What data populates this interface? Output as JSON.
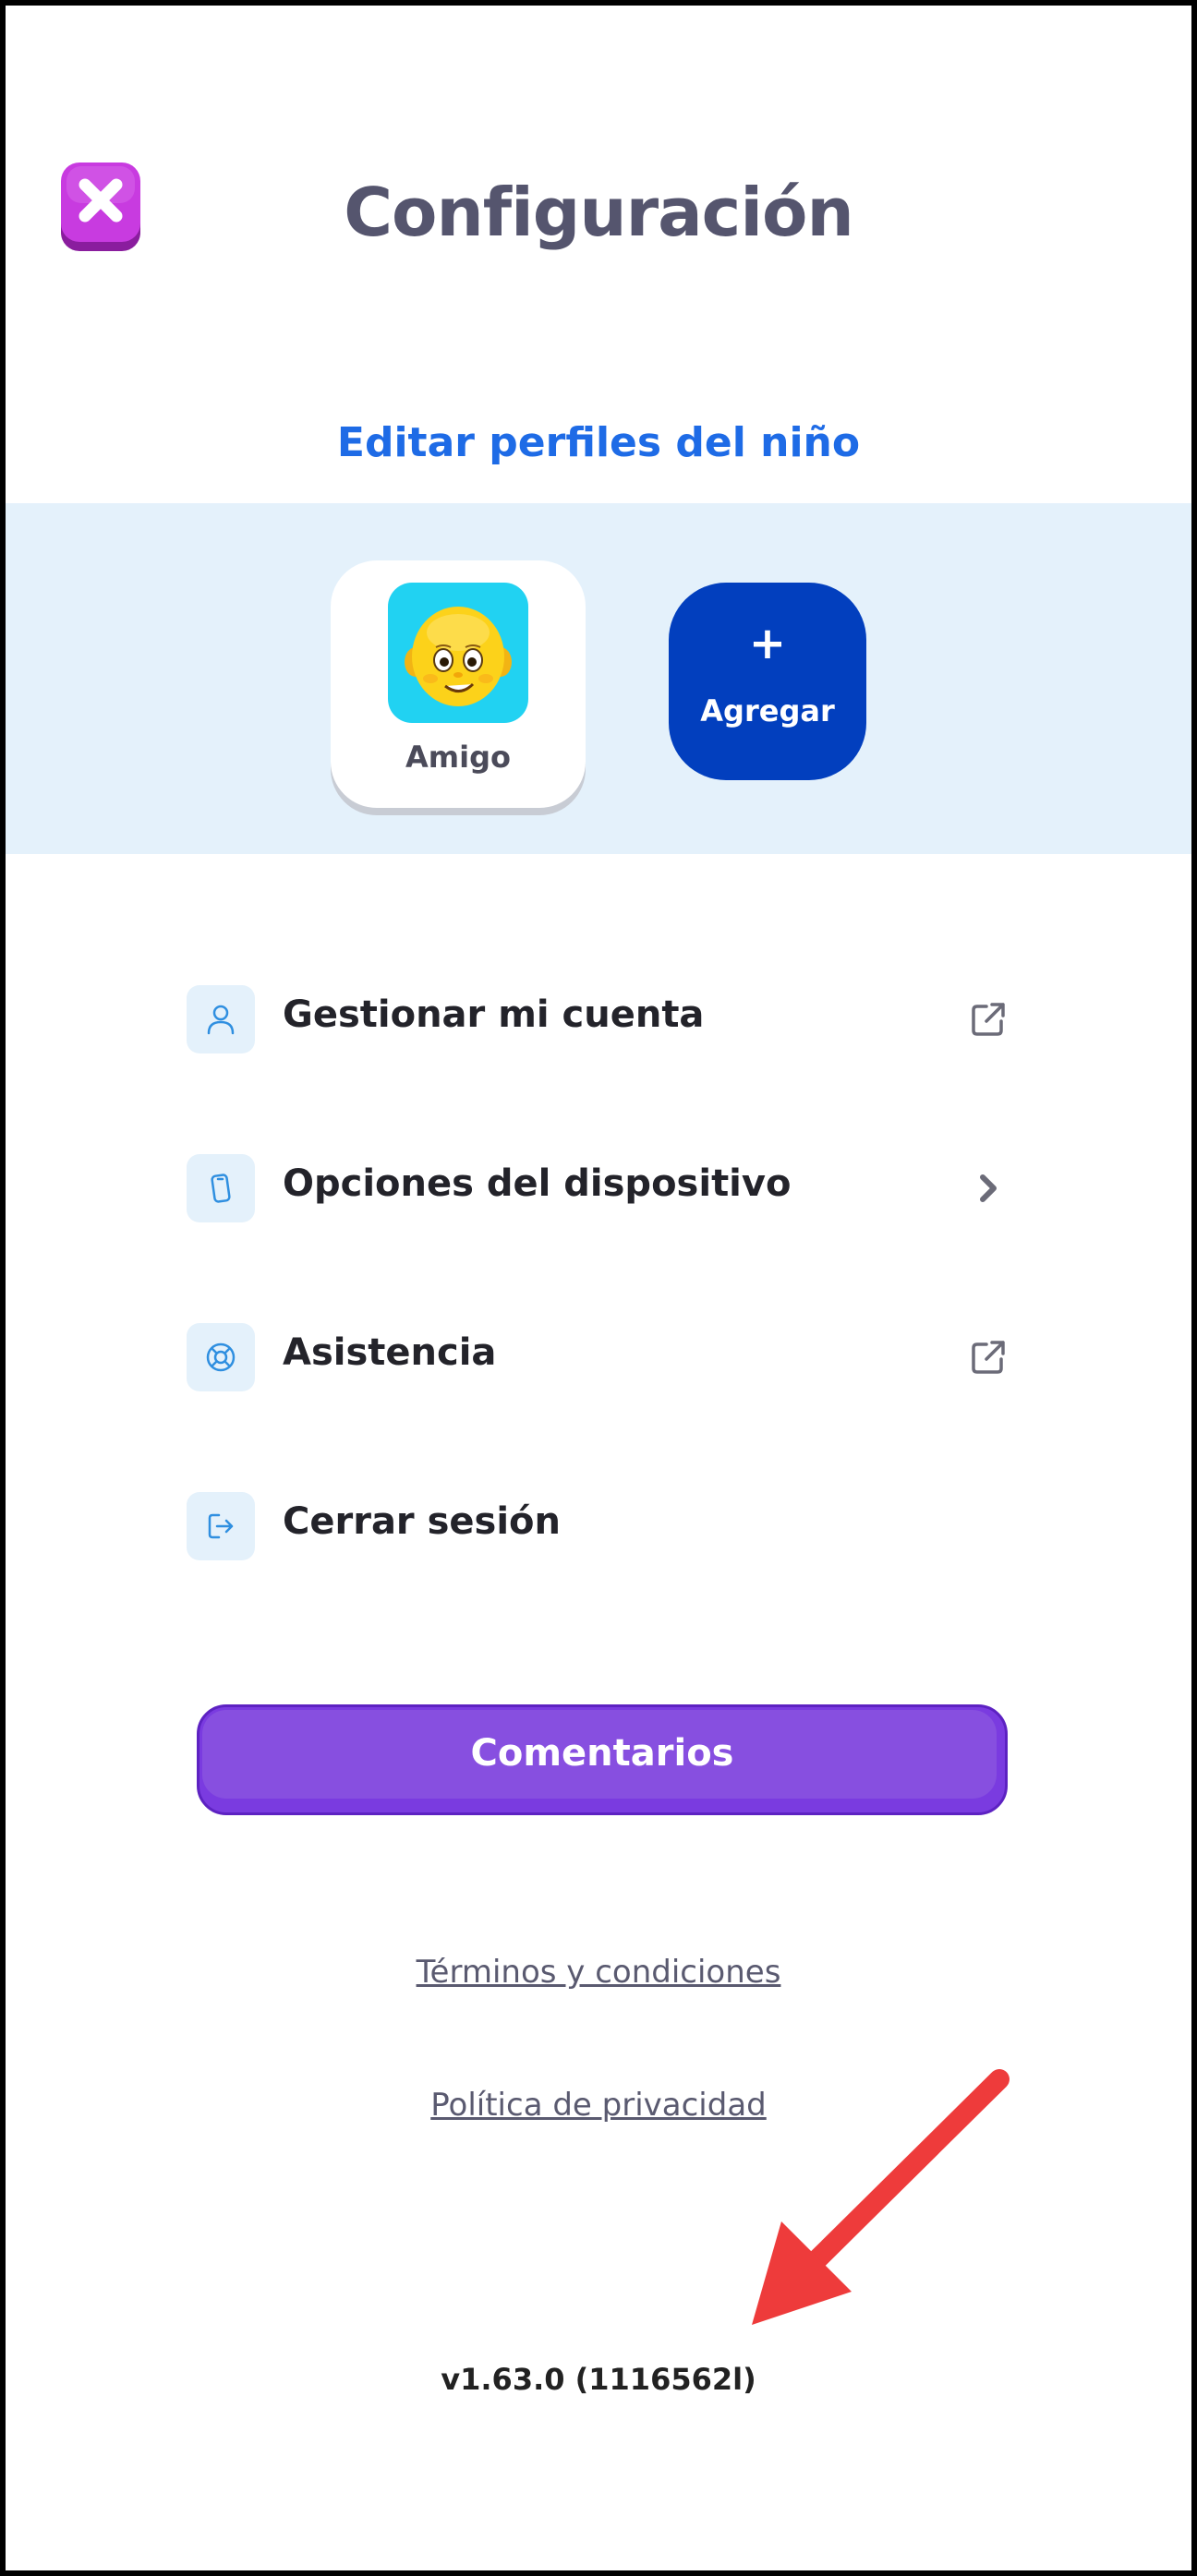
{
  "header": {
    "title": "Configuración",
    "close_icon": "close-icon"
  },
  "profiles": {
    "heading": "Editar perfiles del niño",
    "items": [
      {
        "name": "Amigo",
        "avatar": "baby-face-avatar"
      }
    ],
    "add": {
      "plus": "+",
      "label": "Agregar"
    }
  },
  "menu": {
    "items": [
      {
        "label": "Gestionar mi cuenta",
        "icon": "user-icon",
        "trailing": "external-link-icon"
      },
      {
        "label": "Opciones del dispositivo",
        "icon": "device-icon",
        "trailing": "chevron-right-icon"
      },
      {
        "label": "Asistencia",
        "icon": "lifebuoy-icon",
        "trailing": "external-link-icon"
      },
      {
        "label": "Cerrar sesión",
        "icon": "logout-icon",
        "trailing": ""
      }
    ]
  },
  "feedback_label": "Comentarios",
  "links": {
    "terms": "Términos y condiciones",
    "privacy": "Política de privacidad"
  },
  "version": "v1.63.0 (1116562l)",
  "colors": {
    "accent_blue": "#1e6be6",
    "add_button": "#023fbe",
    "feedback_button": "#7a3be0",
    "band": "#e4f1fb",
    "annotation_arrow": "#ee3b3b"
  }
}
